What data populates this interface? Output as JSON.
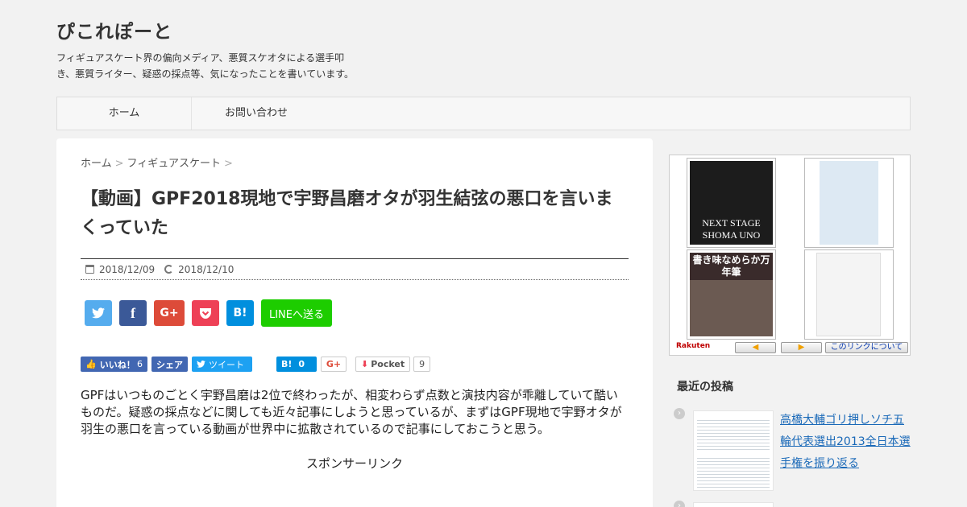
{
  "site": {
    "title": "ぴこれぽーと",
    "description": "フィギュアスケート界の偏向メディア、悪質スケオタによる選手叩き、悪質ライター、疑惑の採点等、気になったことを書いています。"
  },
  "nav": {
    "items": [
      {
        "label": "ホーム"
      },
      {
        "label": "お問い合わせ"
      }
    ]
  },
  "breadcrumb": {
    "home": "ホーム",
    "category": "フィギュアスケート",
    "sep": ">"
  },
  "article": {
    "title": "【動画】GPF2018現地で宇野昌磨オタが羽生結弦の悪口を言いまくっていた",
    "published": "2018/12/09",
    "updated": "2018/12/10",
    "body": "GPFはいつものごとく宇野昌磨は2位で終わったが、相変わらず点数と演技内容が乖離していて酷いものだ。疑惑の採点などに関しても近々記事にしようと思っているが、まずはGPF現地で宇野オタが羽生の悪口を言っている動画が世界中に拡散されているので記事にしておこうと思う。",
    "sponsor": "スポンサーリンク"
  },
  "share_big": {
    "twitter": "🐦",
    "facebook": "f",
    "gplus": "G+",
    "pocket": "⬇",
    "hatena": "B!",
    "line": "LINEへ送る"
  },
  "share_small": {
    "like_label": "いいね！",
    "like_count": "6",
    "share_label": "シェア",
    "tweet_label": "ツイート",
    "hatena_label": "B!",
    "hatena_count": "0",
    "gplus_label": "G+",
    "pocket_label": "Pocket",
    "pocket_count": "9"
  },
  "ad": {
    "item1_title": "NEXT STAGE SHOMA UNO",
    "item3_title": "書き味なめらか万年筆",
    "brand": "Rakuten",
    "prev": "◀",
    "next": "▶",
    "about": "このリンクについて"
  },
  "recent_posts": {
    "title": "最近の投稿",
    "items": [
      {
        "title": "高橋大輔ゴリ押しソチ五輪代表選出2013全日本選手権を振り返る"
      }
    ]
  },
  "colors": {
    "twitter": "#55acee",
    "facebook": "#3b5998",
    "gplus": "#dd4b39",
    "pocket": "#ee4056",
    "hatena": "#008fde",
    "line": "#1dcd00",
    "link": "#1a69b8"
  }
}
